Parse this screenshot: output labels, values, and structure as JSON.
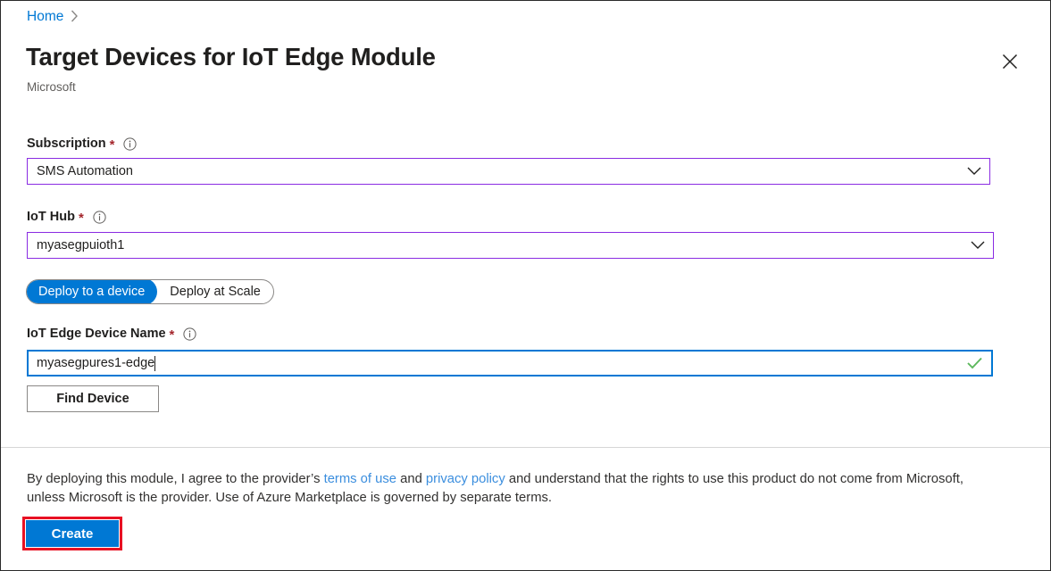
{
  "breadcrumb": {
    "home_label": "Home",
    "chevron_icon": "chevron-right-icon"
  },
  "header": {
    "title": "Target Devices for IoT Edge Module",
    "publisher": "Microsoft",
    "close_icon": "close-icon"
  },
  "form": {
    "subscription": {
      "label": "Subscription",
      "required_marker": "*",
      "info_icon": "info-icon",
      "value": "SMS Automation",
      "chevron_icon": "chevron-down-icon"
    },
    "iot_hub": {
      "label": "IoT Hub",
      "required_marker": "*",
      "info_icon": "info-icon",
      "value": "myasegpuioth1",
      "chevron_icon": "chevron-down-icon"
    },
    "deploy_mode": {
      "options": [
        {
          "label": "Deploy to a device",
          "selected": true
        },
        {
          "label": "Deploy at Scale",
          "selected": false
        }
      ]
    },
    "device_name": {
      "label": "IoT Edge Device Name",
      "required_marker": "*",
      "info_icon": "info-icon",
      "value": "myasegpures1-edge",
      "placeholder": "",
      "validation_icon": "checkmark-icon"
    },
    "find_device_label": "Find Device"
  },
  "footer": {
    "legal_prefix": "By deploying this module, I agree to the provider’s ",
    "terms_link": "terms of use",
    "legal_mid": " and ",
    "privacy_link": "privacy policy",
    "legal_suffix": " and understand that the rights to use this product do not come from Microsoft, unless Microsoft is the provider. Use of Azure Marketplace is governed by separate terms.",
    "create_label": "Create"
  },
  "colors": {
    "accent_blue": "#0078d4",
    "dropdown_border_purple": "#8a2be2",
    "required_red": "#a4262c",
    "link_blue": "#0078d4",
    "legal_link_blue": "#3b8ede",
    "validation_green": "#5cb85c",
    "annotation_red": "#e81123"
  }
}
